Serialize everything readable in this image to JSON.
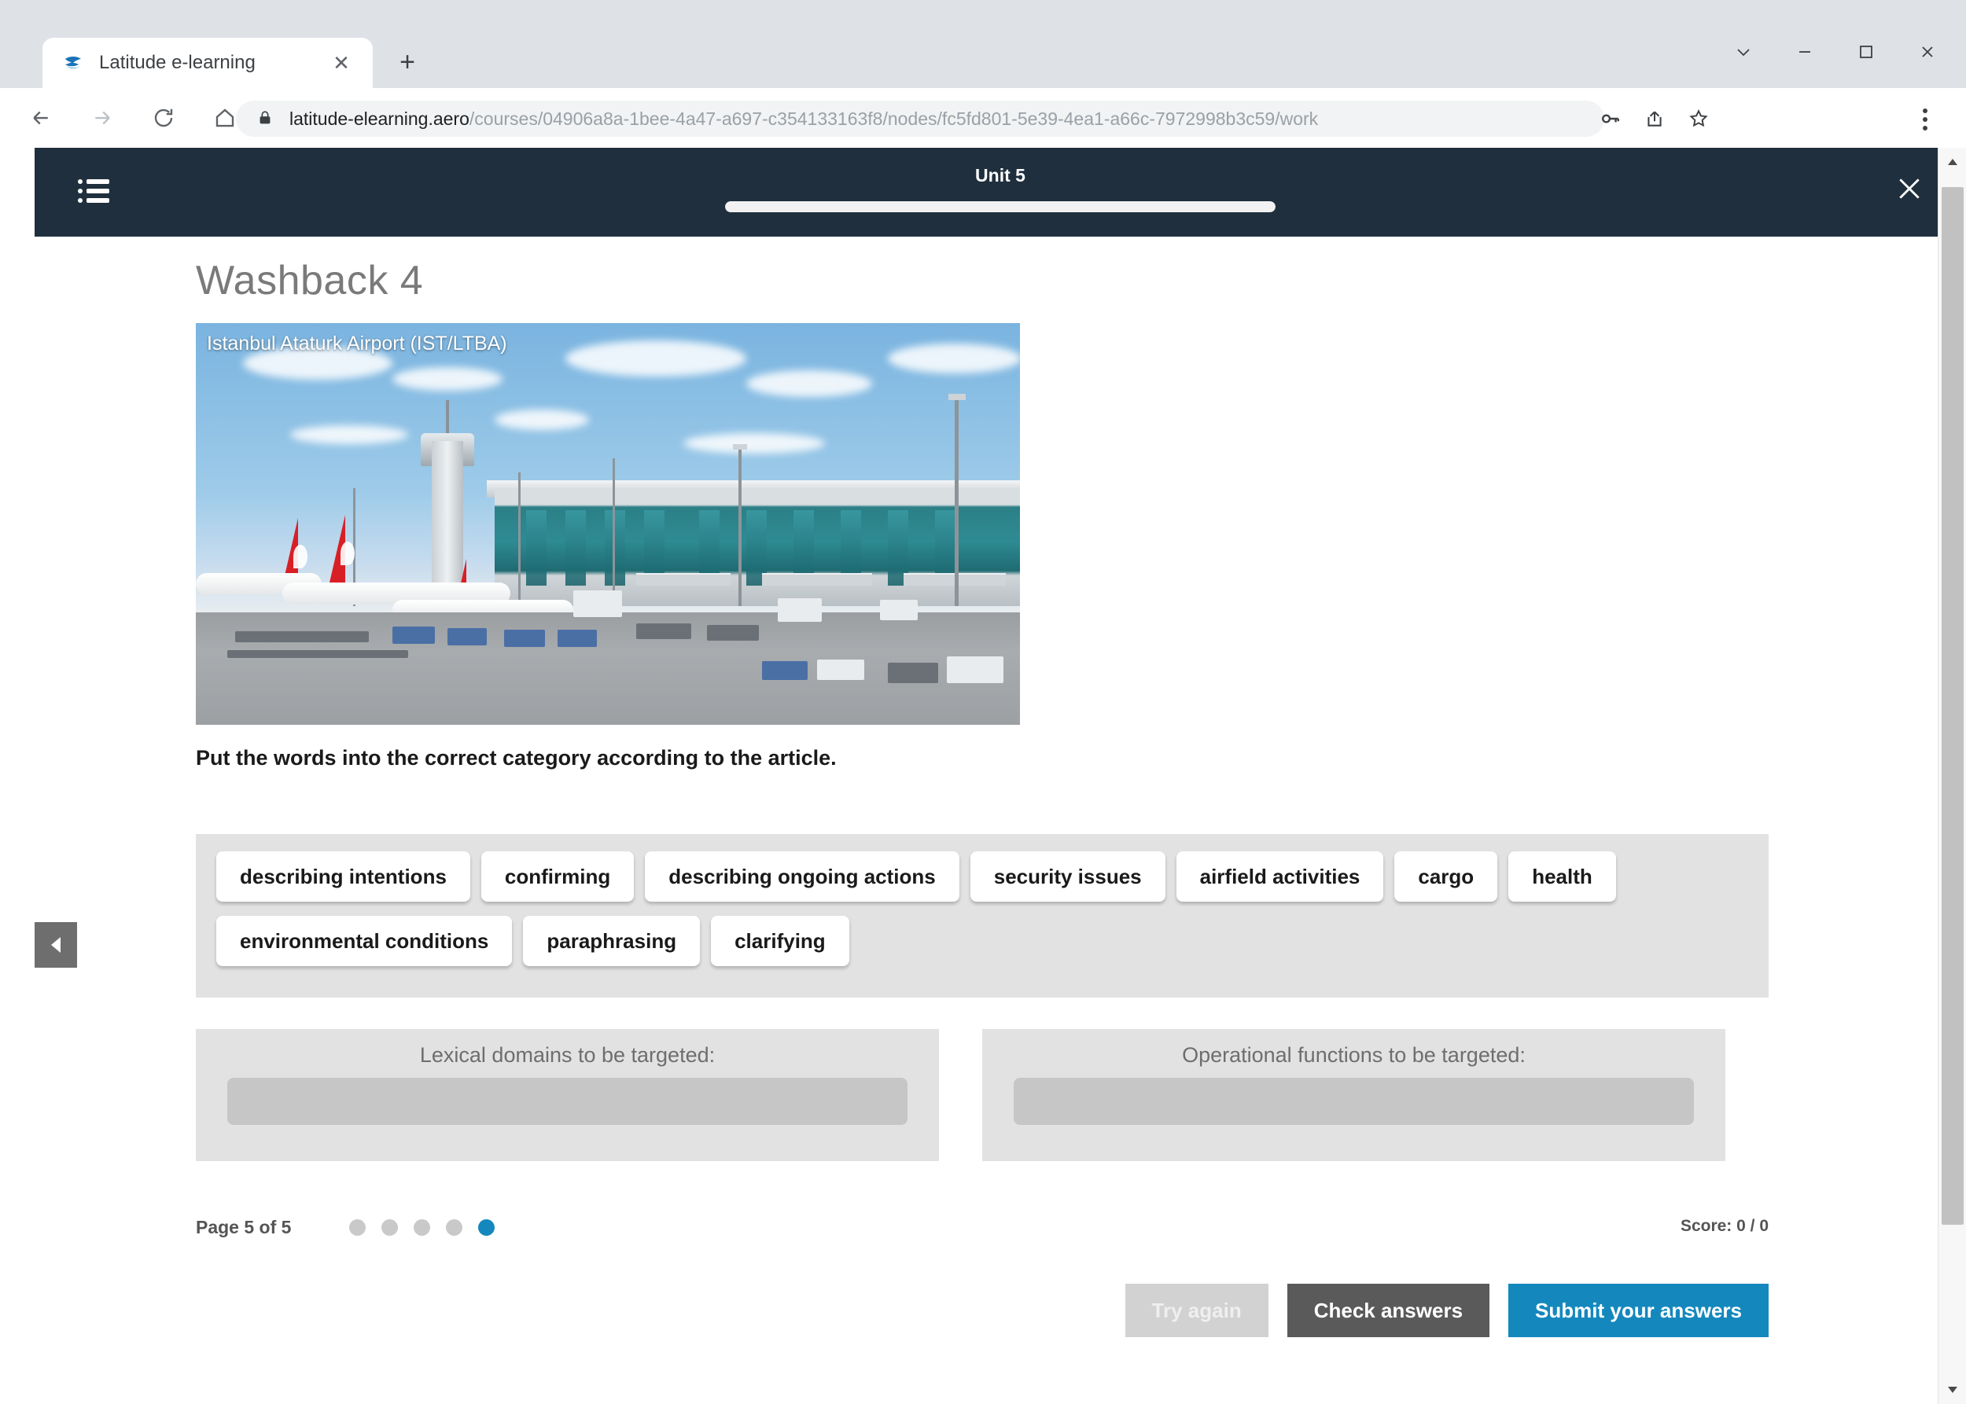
{
  "browser": {
    "tab": {
      "title": "Latitude e-learning",
      "favicon": "latitude-logo-icon",
      "close_icon": "close-icon"
    },
    "new_tab_label": "+",
    "window_controls": [
      {
        "name": "chevron-down",
        "label": "∨"
      },
      {
        "name": "minimize",
        "label": "–"
      },
      {
        "name": "maximize",
        "label": "□"
      },
      {
        "name": "close",
        "label": "✕"
      }
    ],
    "nav": {
      "back": "back-icon",
      "forward": "forward-icon",
      "reload": "reload-icon",
      "home": "home-icon"
    },
    "url": {
      "host": "latitude-elearning.aero",
      "path": "/courses/04906a8a-1bee-4a47-a697-c354133163f8/nodes/fc5fd801-5e39-4ea1-a66c-7972998b3c59/work"
    },
    "omnibox_actions": [
      "key-icon",
      "share-icon",
      "bookmark-star-icon"
    ],
    "menu_icon": "three-dot-menu-icon"
  },
  "app_header": {
    "menu_icon": "list-menu-icon",
    "title": "Unit 5",
    "progress_percent": 100,
    "close_icon": "close-icon"
  },
  "content": {
    "page_title": "Washback 4",
    "photo_caption": "Istanbul Ataturk Airport (IST/LTBA)",
    "instruction": "Put the words into the correct category according to the article."
  },
  "word_chips": [
    "describing intentions",
    "confirming",
    "describing ongoing actions",
    "security issues",
    "airfield activities",
    "cargo",
    "health",
    "environmental conditions",
    "paraphrasing",
    "clarifying"
  ],
  "dropzones": [
    {
      "label": "Lexical domains to be targeted:",
      "items": []
    },
    {
      "label": "Operational functions to be targeted:",
      "items": []
    }
  ],
  "footer": {
    "page_indicator": "Page 5 of 5",
    "total_pages": 5,
    "current_page": 5,
    "score": "Score: 0 / 0",
    "buttons": {
      "try_again": "Try again",
      "check_answers": "Check answers",
      "submit": "Submit your answers"
    }
  },
  "prev_handle_icon": "triangle-left-icon",
  "scrollbar": {
    "up_icon": "caret-up-icon",
    "down_icon": "caret-down-icon"
  },
  "colors": {
    "header_bg": "#1f2f3d",
    "accent_blue": "#1488bd",
    "dark_button": "#5a5a5a",
    "panel_gray": "#e2e2e2",
    "slot_gray": "#c6c6c6"
  }
}
